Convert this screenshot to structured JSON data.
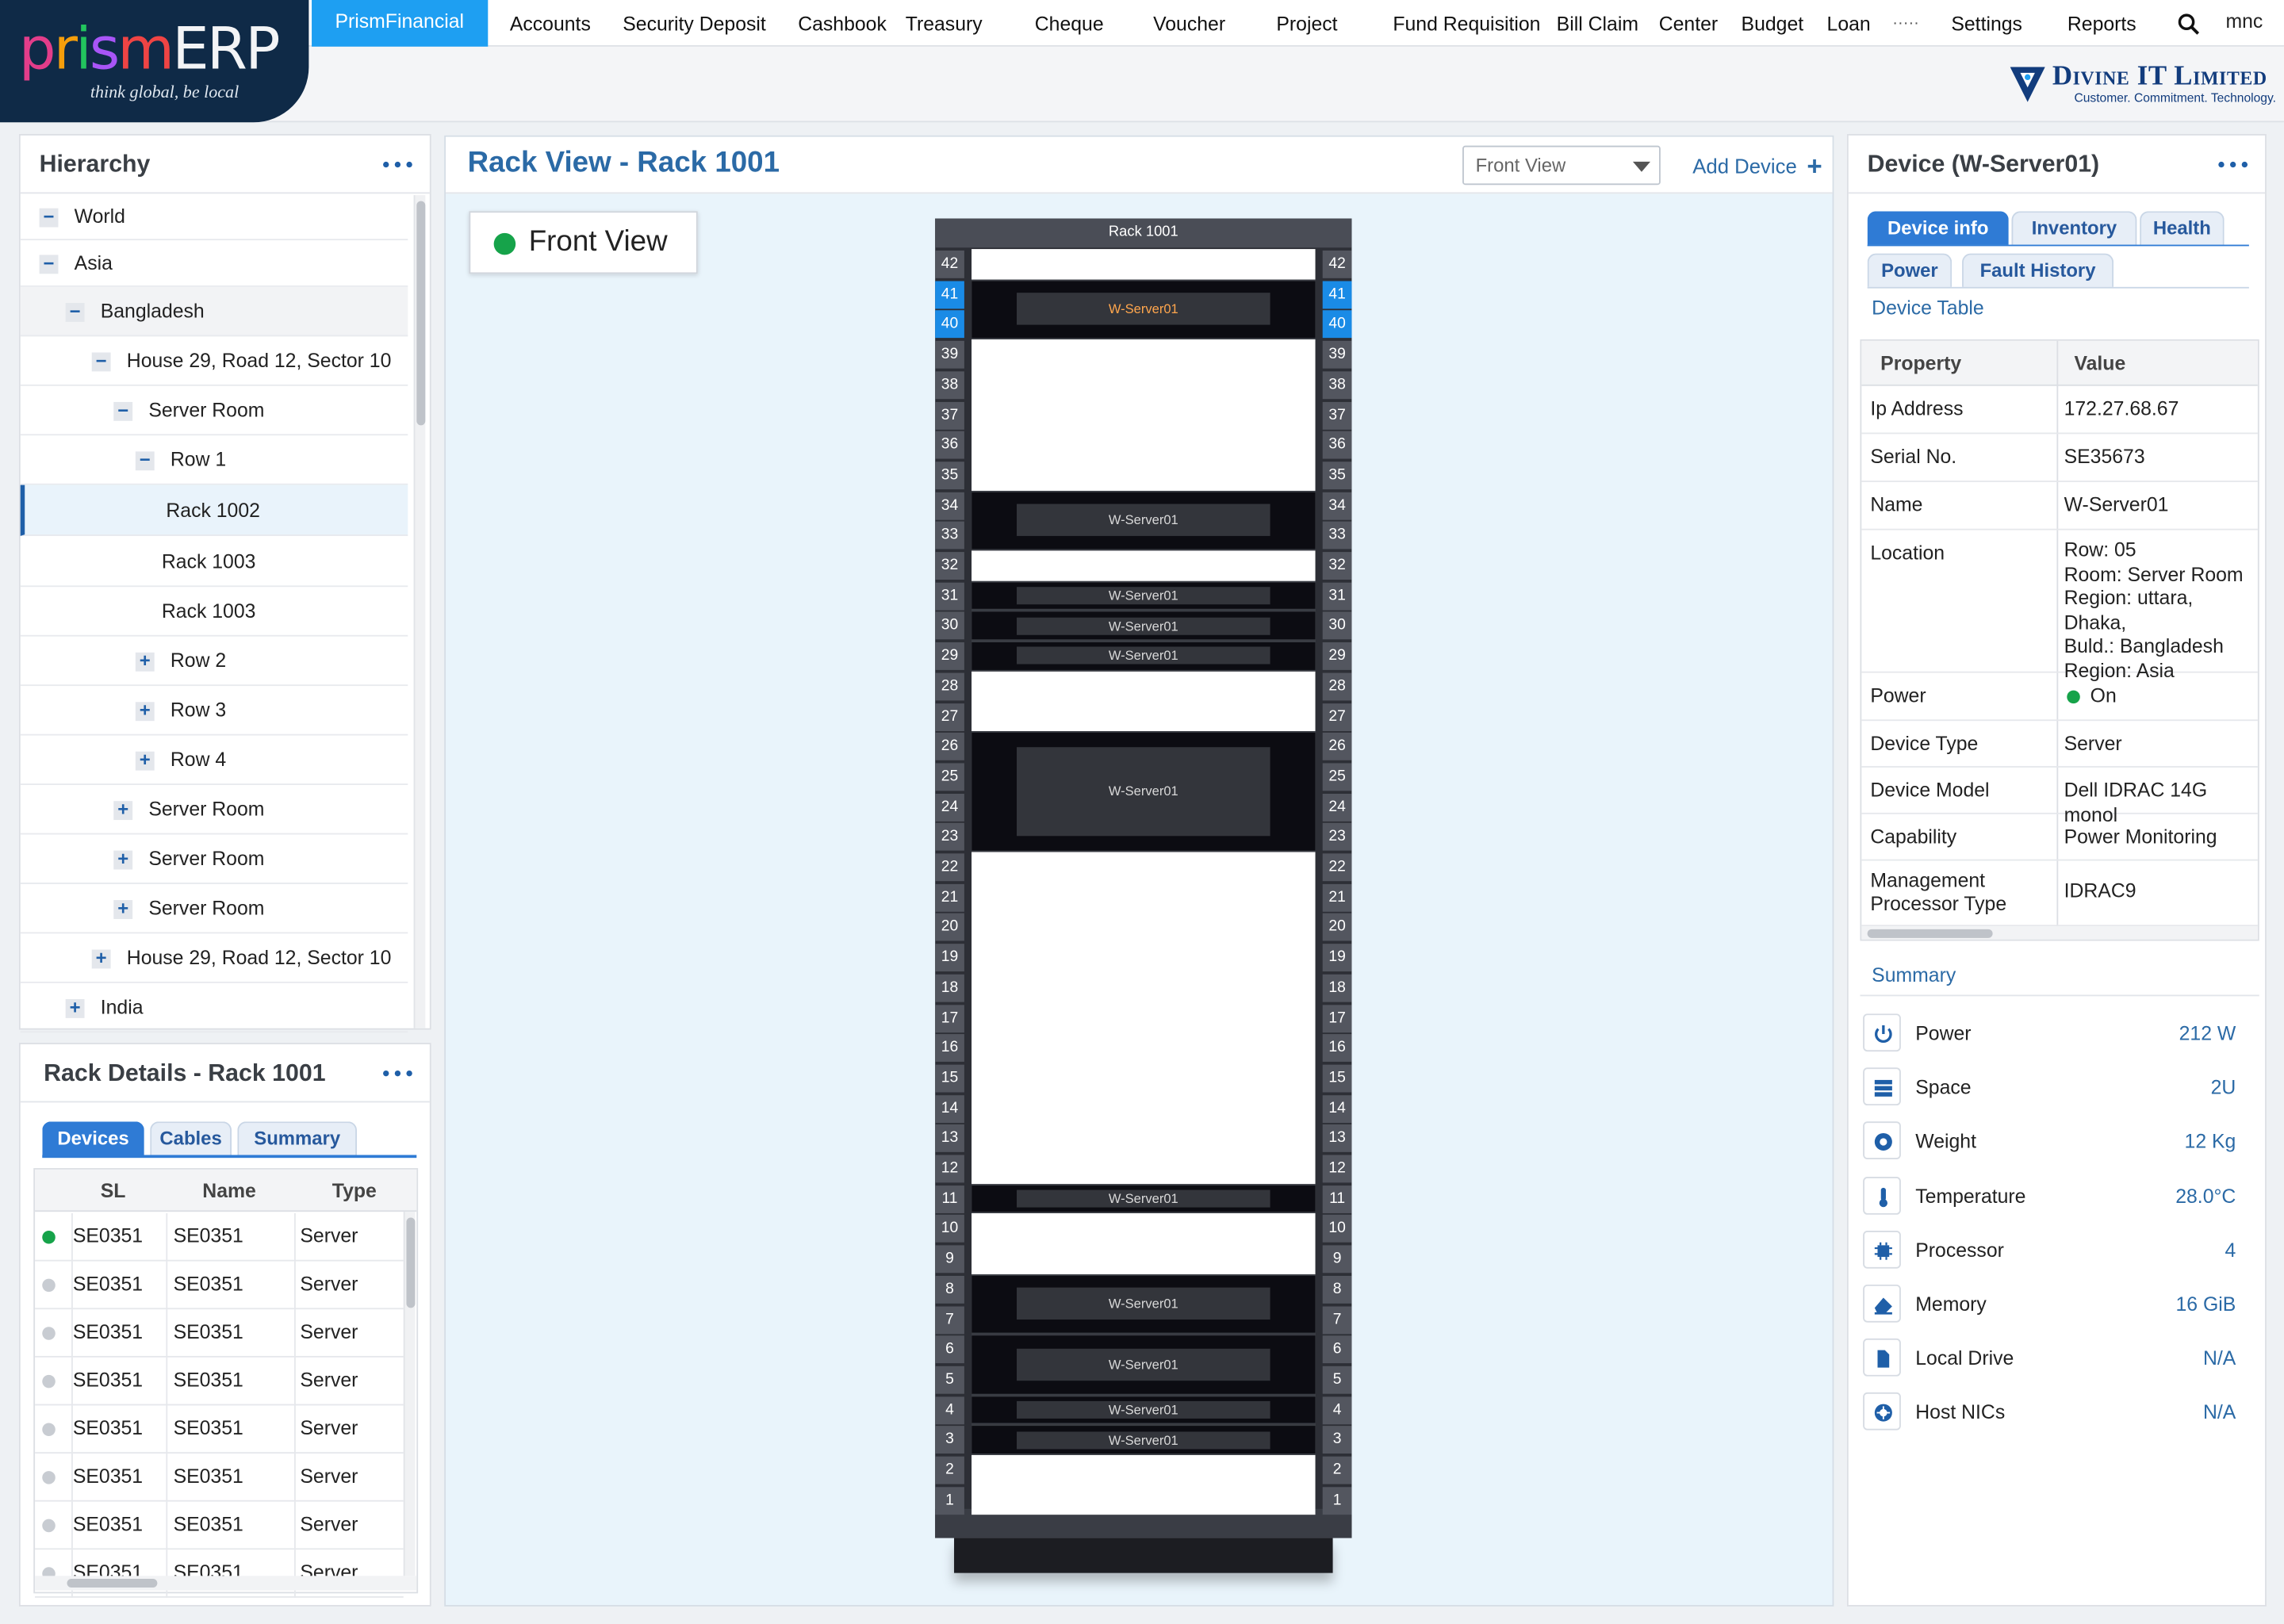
{
  "app": {
    "logo_text": "prismERP",
    "logo_tagline": "think global, be local",
    "brand_name": "Divine IT Limited",
    "brand_tagline": "Customer. Commitment. Technology.",
    "user": "mnc"
  },
  "nav": {
    "active": "PrismFinancial",
    "items": [
      "Accounts",
      "Security Deposit",
      "Cashbook",
      "Treasury",
      "Cheque",
      "Voucher",
      "Project",
      "Fund Requisition",
      "Bill Claim",
      "Center",
      "Budget",
      "Loan"
    ],
    "overflow": "·····",
    "settings": "Settings",
    "reports": "Reports"
  },
  "hierarchy": {
    "title": "Hierarchy",
    "nodes": [
      {
        "label": "World",
        "toggle": "−"
      },
      {
        "label": "Asia",
        "toggle": "−"
      },
      {
        "label": "Bangladesh",
        "toggle": "−"
      },
      {
        "label": "House 29, Road 12, Sector 10",
        "toggle": "−"
      },
      {
        "label": "Server Room",
        "toggle": "−"
      },
      {
        "label": "Row 1",
        "toggle": "−"
      },
      {
        "label": "Rack 1002",
        "toggle": ""
      },
      {
        "label": "Rack 1003",
        "toggle": ""
      },
      {
        "label": "Rack 1003",
        "toggle": ""
      },
      {
        "label": "Row 2",
        "toggle": "+"
      },
      {
        "label": "Row 3",
        "toggle": "+"
      },
      {
        "label": "Row 4",
        "toggle": "+"
      },
      {
        "label": "Server Room",
        "toggle": "+"
      },
      {
        "label": "Server Room",
        "toggle": "+"
      },
      {
        "label": "Server Room",
        "toggle": "+"
      },
      {
        "label": "House 29, Road 12, Sector 10",
        "toggle": "+"
      },
      {
        "label": "India",
        "toggle": "+"
      }
    ]
  },
  "rack_details": {
    "title": "Rack Details - Rack 1001",
    "tabs": [
      "Devices",
      "Cables",
      "Summary"
    ],
    "active_tab": "Devices",
    "columns": [
      "SL",
      "Name",
      "Type"
    ],
    "rows": [
      {
        "status": "online",
        "sl": "SE0351",
        "name": "SE0351",
        "type": "Server"
      },
      {
        "status": "offline",
        "sl": "SE0351",
        "name": "SE0351",
        "type": "Server"
      },
      {
        "status": "offline",
        "sl": "SE0351",
        "name": "SE0351",
        "type": "Server"
      },
      {
        "status": "offline",
        "sl": "SE0351",
        "name": "SE0351",
        "type": "Server"
      },
      {
        "status": "offline",
        "sl": "SE0351",
        "name": "SE0351",
        "type": "Server"
      },
      {
        "status": "offline",
        "sl": "SE0351",
        "name": "SE0351",
        "type": "Server"
      },
      {
        "status": "offline",
        "sl": "SE0351",
        "name": "SE0351",
        "type": "Server"
      },
      {
        "status": "offline",
        "sl": "SE0351",
        "name": "SE0351",
        "type": "Server"
      }
    ]
  },
  "rack_view": {
    "title": "Rack View - Rack 1001",
    "view_select": "Front View",
    "add_device": "Add Device",
    "view_label": "Front View",
    "rack_name": "Rack 1001",
    "total_units": 42,
    "highlight_units": [
      40,
      41
    ],
    "devices": [
      {
        "name": "W-Server01",
        "top_u": 41,
        "units": 2,
        "selected": true
      },
      {
        "name": "W-Server01",
        "top_u": 34,
        "units": 2
      },
      {
        "name": "W-Server01",
        "top_u": 31,
        "units": 1
      },
      {
        "name": "W-Server01",
        "top_u": 30,
        "units": 1
      },
      {
        "name": "W-Server01",
        "top_u": 29,
        "units": 1
      },
      {
        "name": "W-Server01",
        "top_u": 26,
        "units": 4
      },
      {
        "name": "W-Server01",
        "top_u": 11,
        "units": 1
      },
      {
        "name": "W-Server01",
        "top_u": 8,
        "units": 2
      },
      {
        "name": "W-Server01",
        "top_u": 6,
        "units": 2
      },
      {
        "name": "W-Server01",
        "top_u": 4,
        "units": 1
      },
      {
        "name": "W-Server01",
        "top_u": 3,
        "units": 1
      }
    ]
  },
  "device": {
    "title": "Device (W-Server01)",
    "tabs": [
      "Device info",
      "Inventory",
      "Health",
      "Power",
      "Fault History"
    ],
    "active_tab": "Device info",
    "table_label": "Device Table",
    "columns": [
      "Property",
      "Value"
    ],
    "properties": [
      {
        "k": "Ip Address",
        "v": "172.27.68.67"
      },
      {
        "k": "Serial No.",
        "v": "SE35673"
      },
      {
        "k": "Name",
        "v": "W-Server01"
      },
      {
        "k": "Location",
        "v": "Row: 05\nRoom: Server Room\nRegion: uttara, Dhaka,\nBuld.: Bangladesh\nRegion: Asia"
      },
      {
        "k": "Power",
        "v": "On"
      },
      {
        "k": "Device Type",
        "v": "Server"
      },
      {
        "k": "Device Model",
        "v": "Dell IDRAC 14G monol"
      },
      {
        "k": "Capability",
        "v": "Power Monitoring"
      },
      {
        "k": "Management\nProcessor Type",
        "v": "IDRAC9"
      }
    ],
    "summary_label": "Summary",
    "summary": [
      {
        "icon": "power-icon",
        "k": "Power",
        "v": "212 W"
      },
      {
        "icon": "storage-icon",
        "k": "Space",
        "v": "2U"
      },
      {
        "icon": "weight-icon",
        "k": "Weight",
        "v": "12 Kg"
      },
      {
        "icon": "thermometer-icon",
        "k": "Temperature",
        "v": "28.0°C"
      },
      {
        "icon": "processor-icon",
        "k": "Processor",
        "v": "4"
      },
      {
        "icon": "memory-icon",
        "k": "Memory",
        "v": "16 GiB"
      },
      {
        "icon": "file-icon",
        "k": "Local Drive",
        "v": "N/A"
      },
      {
        "icon": "network-icon",
        "k": "Host NICs",
        "v": "N/A"
      }
    ]
  },
  "colors": {
    "accent": "#1e9ff2",
    "link": "#2b6aa6",
    "online": "#16a34a",
    "offline": "#c8ccd2",
    "rack": "#2d2f36"
  }
}
